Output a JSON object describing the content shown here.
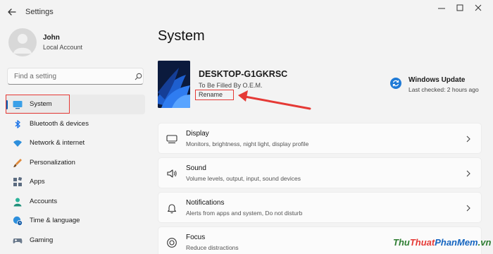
{
  "window": {
    "title": "Settings"
  },
  "user": {
    "name": "John",
    "account_type": "Local Account"
  },
  "search": {
    "placeholder": "Find a setting"
  },
  "sidebar": {
    "items": [
      {
        "label": "System",
        "icon": "monitor-icon",
        "selected": true
      },
      {
        "label": "Bluetooth & devices",
        "icon": "bluetooth-icon"
      },
      {
        "label": "Network & internet",
        "icon": "wifi-icon"
      },
      {
        "label": "Personalization",
        "icon": "brush-icon"
      },
      {
        "label": "Apps",
        "icon": "apps-icon"
      },
      {
        "label": "Accounts",
        "icon": "person-icon"
      },
      {
        "label": "Time & language",
        "icon": "globe-clock-icon"
      },
      {
        "label": "Gaming",
        "icon": "controller-icon"
      }
    ]
  },
  "main": {
    "title": "System",
    "device": {
      "name": "DESKTOP-G1GKRSC",
      "model": "To Be Filled By O.E.M.",
      "rename_label": "Rename"
    },
    "windows_update": {
      "title": "Windows Update",
      "status": "Last checked: 2 hours ago"
    },
    "cards": [
      {
        "title": "Display",
        "subtitle": "Monitors, brightness, night light, display profile",
        "icon": "display-icon"
      },
      {
        "title": "Sound",
        "subtitle": "Volume levels, output, input, sound devices",
        "icon": "speaker-icon"
      },
      {
        "title": "Notifications",
        "subtitle": "Alerts from apps and system, Do not disturb",
        "icon": "bell-icon"
      },
      {
        "title": "Focus",
        "subtitle": "Reduce distractions",
        "icon": "focus-icon"
      }
    ]
  },
  "watermark": {
    "part1": "Thu",
    "part2": "Thuat",
    "part3": "PhanMem",
    "part4": ".vn"
  },
  "colors": {
    "accent": "#005fb8",
    "annotation": "#e53935",
    "background": "#f3f3f3"
  }
}
